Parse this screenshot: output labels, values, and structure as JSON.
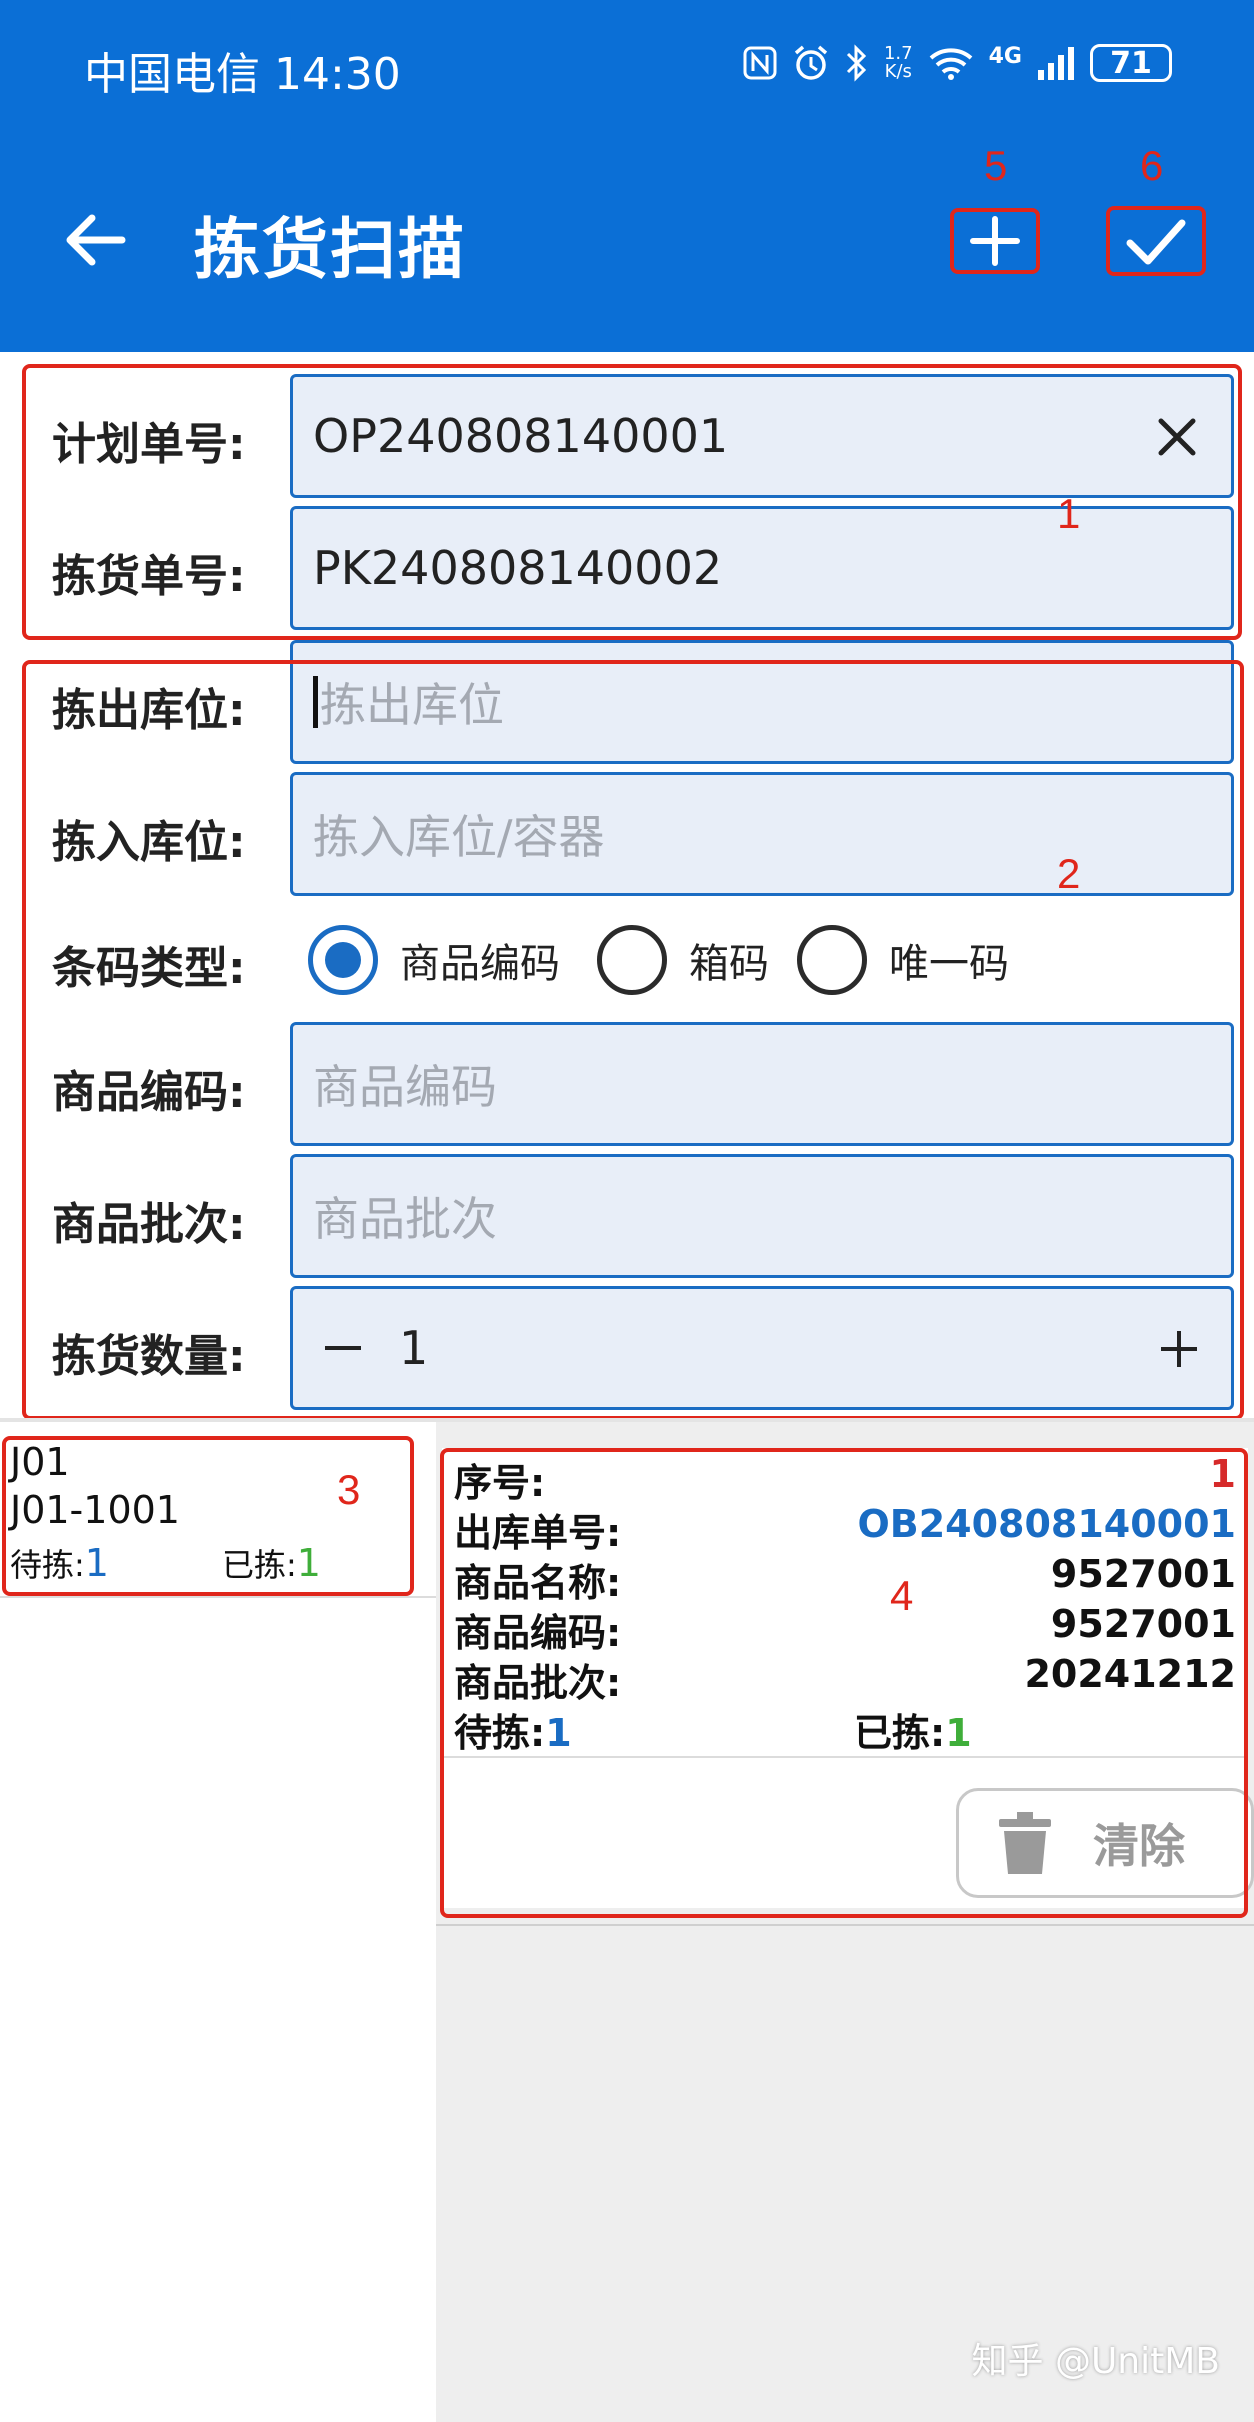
{
  "status_bar": {
    "carrier_time": "中国电信 14:30",
    "net_speed": "1.7\nK/s",
    "signal": "4G",
    "battery": "71"
  },
  "header": {
    "title": "拣货扫描"
  },
  "annotations": [
    "1",
    "2",
    "3",
    "4",
    "5",
    "6"
  ],
  "form": {
    "plan_no_label": "计划单号:",
    "plan_no_value": "OP240808140001",
    "pick_no_label": "拣货单号:",
    "pick_no_value": "PK240808140002",
    "out_loc_label": "拣出库位:",
    "out_loc_placeholder": "拣出库位",
    "in_loc_label": "拣入库位:",
    "in_loc_placeholder": "拣入库位/容器",
    "barcode_type_label": "条码类型:",
    "barcode_options": [
      "商品编码",
      "箱码",
      "唯一码"
    ],
    "barcode_selected": "商品编码",
    "sku_label": "商品编码:",
    "sku_placeholder": "商品编码",
    "batch_label": "商品批次:",
    "batch_placeholder": "商品批次",
    "qty_label": "拣货数量:",
    "qty_value": "1"
  },
  "location_list": [
    {
      "zone": "J01",
      "location": "J01-1001",
      "pending_label": "待拣:",
      "pending": "1",
      "picked_label": "已拣:",
      "picked": "1"
    }
  ],
  "detail_card": {
    "seq_label": "序号:",
    "seq_value": "1",
    "outbound_label": "出库单号:",
    "outbound_value": "OB240808140001",
    "name_label": "商品名称:",
    "name_value": "9527001",
    "sku_label": "商品编码:",
    "sku_value": "9527001",
    "batch_label": "商品批次:",
    "batch_value": "20241212",
    "pending_label": "待拣:",
    "pending": "1",
    "picked_label": "已拣:",
    "picked": "1",
    "clear_label": "清除"
  },
  "watermark": "知乎 @UnitMB",
  "colors": {
    "header": "#0b6fd6",
    "accent": "#1a6cc3",
    "annotation": "#e0261b",
    "picked_green": "#3fae3a",
    "seq_red": "#d62a2a"
  }
}
